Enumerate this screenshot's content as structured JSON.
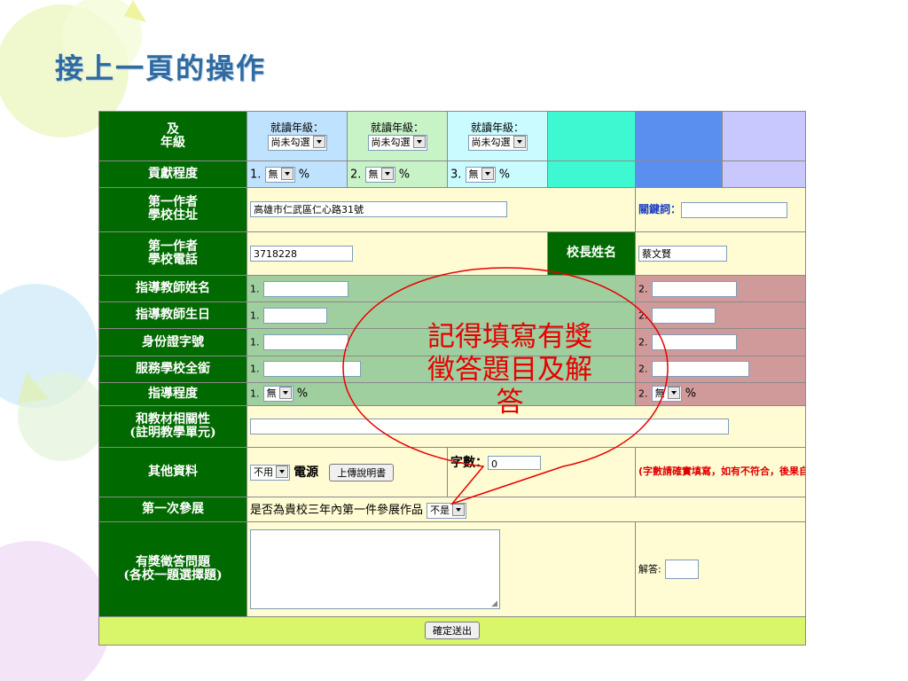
{
  "slide": {
    "title": "接上一頁的操作"
  },
  "colors": {
    "label_bg": "#006a00",
    "title": "#2f6aa0",
    "callout": "#e80000",
    "submit_bar": "#d9f56a"
  },
  "form": {
    "grade": {
      "label_line1": "及",
      "label_line2": "年級",
      "items": [
        {
          "caption": "就讀年級：",
          "value": "尚未勾選"
        },
        {
          "caption": "就讀年級：",
          "value": "尚未勾選"
        },
        {
          "caption": "就讀年級：",
          "value": "尚未勾選"
        }
      ]
    },
    "contribution": {
      "label": "貢獻程度",
      "items": [
        {
          "num": "1.",
          "value": "無",
          "unit": "%"
        },
        {
          "num": "2.",
          "value": "無",
          "unit": "%"
        },
        {
          "num": "3.",
          "value": "無",
          "unit": "%"
        }
      ]
    },
    "address": {
      "label_line1": "第一作者",
      "label_line2": "學校住址",
      "value": "高雄市仁武區仁心路31號",
      "keyword_label": "關鍵詞：",
      "keyword_value": ""
    },
    "phone": {
      "label_line1": "第一作者",
      "label_line2": "學校電話",
      "value": "3718228",
      "principal_label": "校長姓名",
      "principal_value": "蔡文賢"
    },
    "teacher_name": {
      "label": "指導教師姓名",
      "n1": "1.",
      "n2": "2."
    },
    "teacher_birthday": {
      "label": "指導教師生日",
      "n1": "1.",
      "n2": "2."
    },
    "id_number": {
      "label": "身份證字號",
      "n1": "1.",
      "n2": "2."
    },
    "school_title": {
      "label": "服務學校全銜",
      "n1": "1.",
      "n2": "2."
    },
    "guidance": {
      "label": "指導程度",
      "n1": "1.",
      "v1": "無",
      "u1": "%",
      "n2": "2.",
      "v2": "無",
      "u2": "%"
    },
    "relevance": {
      "label_line1": "和教材相關性",
      "label_line2": "(註明教學單元)",
      "value": ""
    },
    "other": {
      "label": "其他資料",
      "select_value": "不用",
      "power_label": "電源",
      "upload_label": "上傳說明書",
      "word_count_label": "字數：",
      "word_count_value": "0",
      "note": "(字數請確實填寫，如有不符合，後果自負!!)"
    },
    "first_exhibit": {
      "label": "第一次參展",
      "question": "是否為貴校三年內第一件參展作品",
      "value": "不是"
    },
    "quiz": {
      "label_line1": "有獎徵答問題",
      "label_line2": "(各校一題選擇題)",
      "answer_label": "解答:",
      "answer_value": ""
    },
    "submit_label": "確定送出"
  },
  "callout": {
    "text_line1": "記得填寫有獎",
    "text_line2": "徵答題目及解",
    "text_line3": "答"
  }
}
